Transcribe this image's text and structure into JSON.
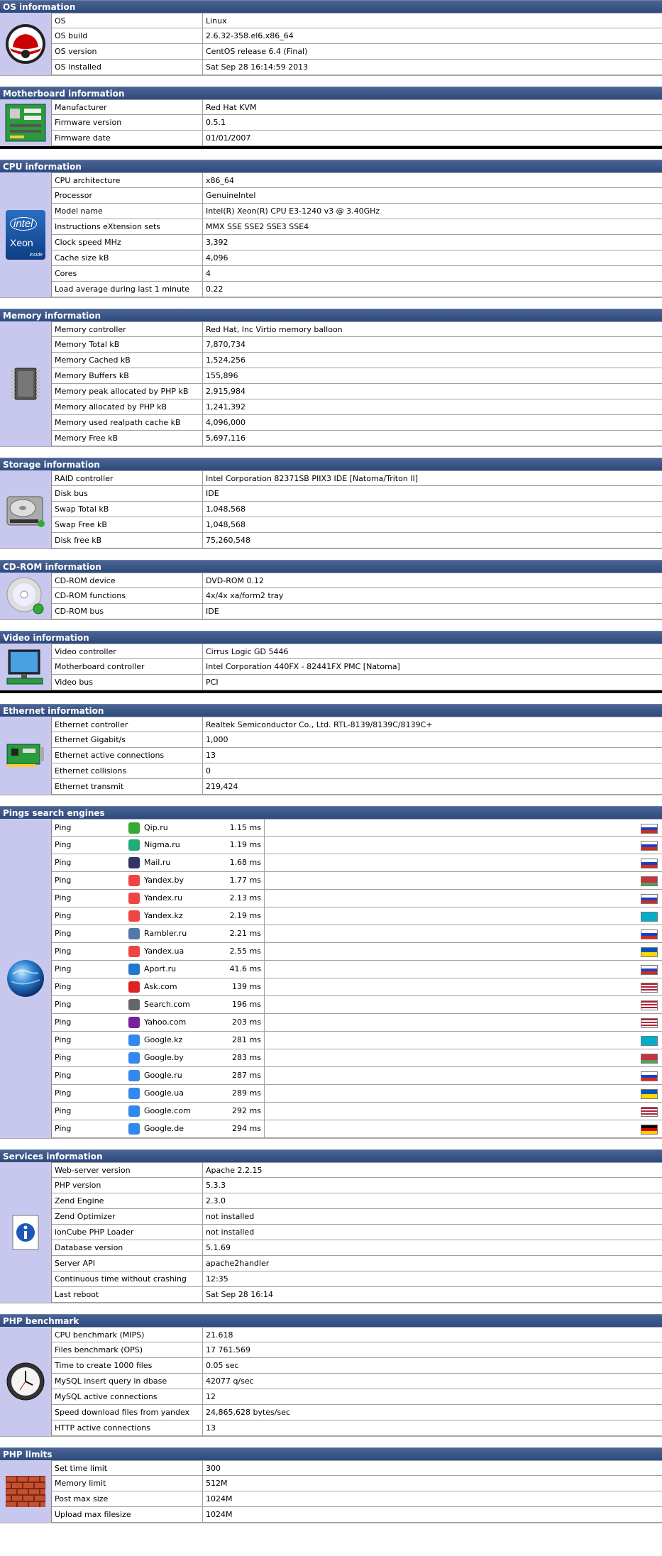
{
  "colors": {
    "header_bg": "#2d4a7d",
    "icon_bg": "#c8c8ee"
  },
  "sections": {
    "os": {
      "title": "OS information",
      "icon": "redhat-logo-icon",
      "rows": [
        {
          "k": "OS",
          "v": "Linux"
        },
        {
          "k": "OS build",
          "v": "2.6.32-358.el6.x86_64"
        },
        {
          "k": "OS version",
          "v": "CentOS release 6.4 (Final)"
        },
        {
          "k": "OS installed",
          "v": "Sat Sep 28 16:14:59 2013"
        }
      ]
    },
    "mb": {
      "title": "Motherboard information",
      "icon": "motherboard-icon",
      "rows": [
        {
          "k": "Manufacturer",
          "v": "Red Hat KVM"
        },
        {
          "k": "Firmware version",
          "v": "0.5.1"
        },
        {
          "k": "Firmware date",
          "v": "01/01/2007"
        }
      ]
    },
    "cpu": {
      "title": "CPU information",
      "icon": "intel-xeon-icon",
      "icon_text": {
        "brand": "intel",
        "model": "Xeon",
        "suffix": "inside"
      },
      "rows": [
        {
          "k": "CPU architecture",
          "v": "x86_64"
        },
        {
          "k": "Processor",
          "v": "GenuineIntel"
        },
        {
          "k": "Model name",
          "v": "Intel(R) Xeon(R) CPU E3-1240 v3 @ 3.40GHz"
        },
        {
          "k": "Instructions eXtension sets",
          "v": "MMX SSE SSE2 SSE3 SSE4"
        },
        {
          "k": "Clock speed MHz",
          "v": "3,392"
        },
        {
          "k": "Cache size kB",
          "v": "4,096"
        },
        {
          "k": "Cores",
          "v": "4"
        },
        {
          "k": "Load average during last 1 minute",
          "v": "0.22"
        }
      ]
    },
    "mem": {
      "title": "Memory information",
      "icon": "memory-chip-icon",
      "rows": [
        {
          "k": "Memory controller",
          "v": "Red Hat, Inc Virtio memory balloon"
        },
        {
          "k": "Memory Total kB",
          "v": "7,870,734"
        },
        {
          "k": "Memory Cached kB",
          "v": "1,524,256"
        },
        {
          "k": "Memory Buffers kB",
          "v": "155,896"
        },
        {
          "k": "Memory peak allocated by PHP kB",
          "v": "2,915,984"
        },
        {
          "k": "Memory allocated by PHP kB",
          "v": "1,241,392"
        },
        {
          "k": "Memory used realpath cache kB",
          "v": "4,096,000"
        },
        {
          "k": "Memory Free kB",
          "v": "5,697,116"
        }
      ]
    },
    "storage": {
      "title": "Storage information",
      "icon": "hard-disk-icon",
      "rows": [
        {
          "k": "RAID controller",
          "v": "Intel Corporation 82371SB PIIX3 IDE [Natoma/Triton II]"
        },
        {
          "k": "Disk bus",
          "v": "IDE"
        },
        {
          "k": "Swap Total kB",
          "v": "1,048,568"
        },
        {
          "k": "Swap Free kB",
          "v": "1,048,568"
        },
        {
          "k": "Disk free kB",
          "v": "75,260,548"
        }
      ]
    },
    "cdrom": {
      "title": "CD-ROM information",
      "icon": "cd-disc-icon",
      "rows": [
        {
          "k": "CD-ROM device",
          "v": "DVD-ROM 0.12"
        },
        {
          "k": "CD-ROM functions",
          "v": "4x/4x xa/form2 tray"
        },
        {
          "k": "CD-ROM bus",
          "v": "IDE"
        }
      ]
    },
    "video": {
      "title": "Video information",
      "icon": "monitor-icon",
      "rows": [
        {
          "k": "Video controller",
          "v": "Cirrus Logic GD 5446"
        },
        {
          "k": "Motherboard controller",
          "v": "Intel Corporation 440FX - 82441FX PMC [Natoma]"
        },
        {
          "k": "Video bus",
          "v": "PCI"
        }
      ]
    },
    "eth": {
      "title": "Ethernet information",
      "icon": "network-card-icon",
      "rows": [
        {
          "k": "Ethernet controller",
          "v": "Realtek Semiconductor Co., Ltd. RTL-8139/8139C/8139C+"
        },
        {
          "k": "Ethernet Gigabit/s",
          "v": "1,000"
        },
        {
          "k": "Ethernet active connections",
          "v": "13"
        },
        {
          "k": "Ethernet collisions",
          "v": "0"
        },
        {
          "k": "Ethernet transmit",
          "v": "219,424"
        }
      ]
    },
    "pings": {
      "title": "Pings search engines",
      "icon": "globe-icon",
      "rows": [
        {
          "label": "Ping",
          "name": "Qip.ru",
          "time": "1.15 ms",
          "icon": "qip-icon",
          "icon_color": "#3a3",
          "flag": "ru"
        },
        {
          "label": "Ping",
          "name": "Nigma.ru",
          "time": "1.19 ms",
          "icon": "nigma-icon",
          "icon_color": "#2a7",
          "flag": "ru"
        },
        {
          "label": "Ping",
          "name": "Mail.ru",
          "time": "1.68 ms",
          "icon": "mailru-icon",
          "icon_color": "#336",
          "flag": "ru"
        },
        {
          "label": "Ping",
          "name": "Yandex.by",
          "time": "1.77 ms",
          "icon": "yandex-icon",
          "icon_color": "#e44",
          "flag": "by"
        },
        {
          "label": "Ping",
          "name": "Yandex.ru",
          "time": "2.13 ms",
          "icon": "yandex-icon",
          "icon_color": "#e44",
          "flag": "ru"
        },
        {
          "label": "Ping",
          "name": "Yandex.kz",
          "time": "2.19 ms",
          "icon": "yandex-icon",
          "icon_color": "#e44",
          "flag": "kz"
        },
        {
          "label": "Ping",
          "name": "Rambler.ru",
          "time": "2.21 ms",
          "icon": "rambler-icon",
          "icon_color": "#57a",
          "flag": "ru"
        },
        {
          "label": "Ping",
          "name": "Yandex.ua",
          "time": "2.55 ms",
          "icon": "yandex-icon",
          "icon_color": "#e44",
          "flag": "ua"
        },
        {
          "label": "Ping",
          "name": "Aport.ru",
          "time": "41.6 ms",
          "icon": "aport-icon",
          "icon_color": "#27c",
          "flag": "ru"
        },
        {
          "label": "Ping",
          "name": "Ask.com",
          "time": "139 ms",
          "icon": "ask-icon",
          "icon_color": "#d22",
          "flag": "us"
        },
        {
          "label": "Ping",
          "name": "Search.com",
          "time": "196 ms",
          "icon": "search-com-icon",
          "icon_color": "#666",
          "flag": "us"
        },
        {
          "label": "Ping",
          "name": "Yahoo.com",
          "time": "203 ms",
          "icon": "yahoo-icon",
          "icon_color": "#729",
          "flag": "us"
        },
        {
          "label": "Ping",
          "name": "Google.kz",
          "time": "281 ms",
          "icon": "google-icon",
          "icon_color": "#38e",
          "flag": "kz"
        },
        {
          "label": "Ping",
          "name": "Google.by",
          "time": "283 ms",
          "icon": "google-icon",
          "icon_color": "#38e",
          "flag": "by"
        },
        {
          "label": "Ping",
          "name": "Google.ru",
          "time": "287 ms",
          "icon": "google-icon",
          "icon_color": "#38e",
          "flag": "ru"
        },
        {
          "label": "Ping",
          "name": "Google.ua",
          "time": "289 ms",
          "icon": "google-icon",
          "icon_color": "#38e",
          "flag": "ua"
        },
        {
          "label": "Ping",
          "name": "Google.com",
          "time": "292 ms",
          "icon": "google-icon",
          "icon_color": "#38e",
          "flag": "us"
        },
        {
          "label": "Ping",
          "name": "Google.de",
          "time": "294 ms",
          "icon": "google-icon",
          "icon_color": "#38e",
          "flag": "de"
        }
      ]
    },
    "services": {
      "title": "Services information",
      "icon": "info-icon",
      "rows": [
        {
          "k": "Web-server version",
          "v": "Apache 2.2.15"
        },
        {
          "k": "PHP version",
          "v": "5.3.3"
        },
        {
          "k": "Zend Engine",
          "v": "2.3.0"
        },
        {
          "k": "Zend Optimizer",
          "v": "not installed"
        },
        {
          "k": "ionCube PHP Loader",
          "v": "not installed"
        },
        {
          "k": "Database version",
          "v": "5.1.69"
        },
        {
          "k": "Server API",
          "v": "apache2handler"
        },
        {
          "k": "Continuous time without crashing",
          "v": "12:35"
        },
        {
          "k": "Last reboot",
          "v": "Sat Sep 28 16:14"
        }
      ]
    },
    "bench": {
      "title": "PHP benchmark",
      "icon": "clock-icon",
      "rows": [
        {
          "k": "CPU benchmark (MIPS)",
          "v": "21.618"
        },
        {
          "k": "Files benchmark (OPS)",
          "v": "17 761.569"
        },
        {
          "k": "Time to create 1000 files",
          "v": "0.05 sec"
        },
        {
          "k": "MySQL insert query in dbase",
          "v": "42077 q/sec"
        },
        {
          "k": "MySQL active connections",
          "v": "12"
        },
        {
          "k": "Speed download files from yandex",
          "v": "24,865,628 bytes/sec"
        },
        {
          "k": "HTTP active connections",
          "v": "13"
        }
      ]
    },
    "limits": {
      "title": "PHP limits",
      "icon": "brick-wall-icon",
      "rows": [
        {
          "k": "Set time limit",
          "v": "300"
        },
        {
          "k": "Memory limit",
          "v": "512M"
        },
        {
          "k": "Post max size",
          "v": "1024M"
        },
        {
          "k": "Upload max filesize",
          "v": "1024M"
        }
      ]
    }
  }
}
